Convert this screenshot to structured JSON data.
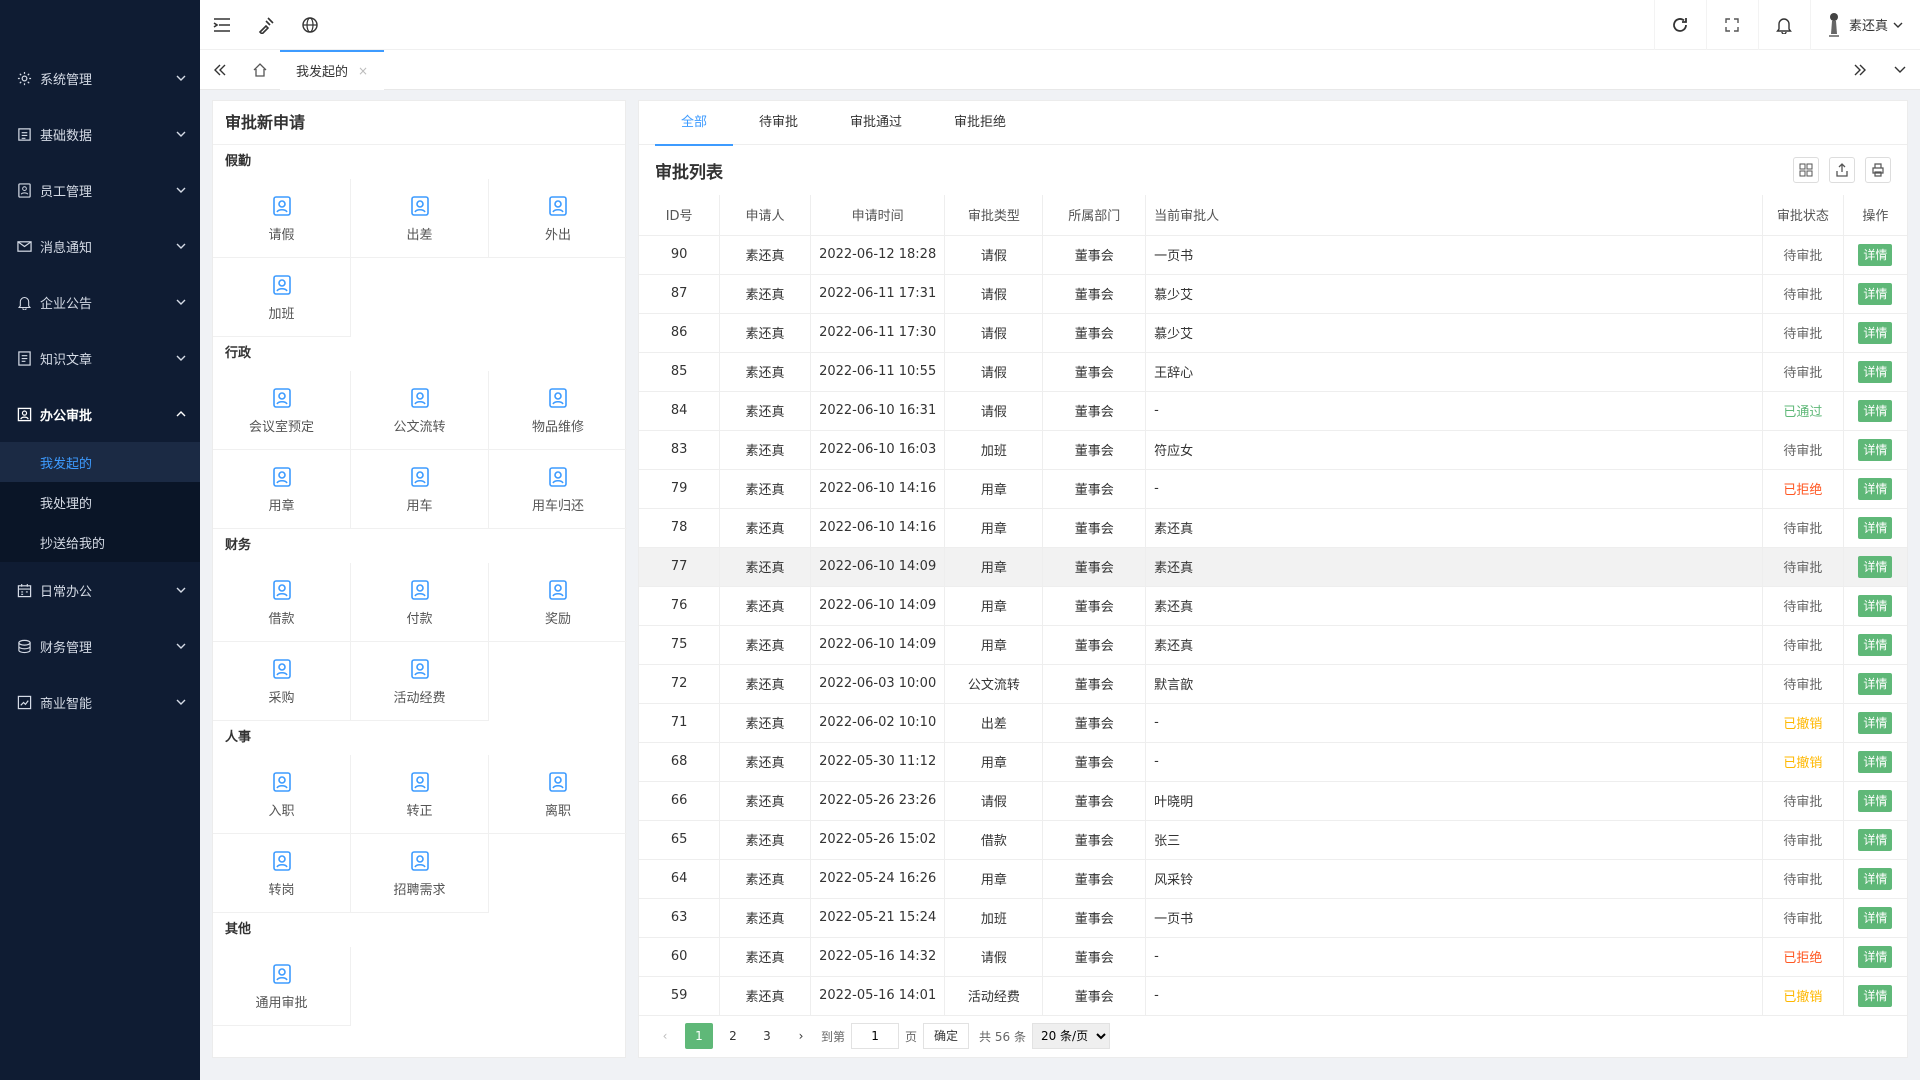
{
  "sidebar": {
    "items": [
      {
        "label": "系统管理",
        "icon": "gear-icon"
      },
      {
        "label": "基础数据",
        "icon": "database-icon"
      },
      {
        "label": "员工管理",
        "icon": "employee-icon"
      },
      {
        "label": "消息通知",
        "icon": "message-icon"
      },
      {
        "label": "企业公告",
        "icon": "bell-icon"
      },
      {
        "label": "知识文章",
        "icon": "article-icon"
      },
      {
        "label": "办公审批",
        "icon": "approval-icon"
      },
      {
        "label": "日常办公",
        "icon": "calendar-icon"
      },
      {
        "label": "财务管理",
        "icon": "finance-icon"
      },
      {
        "label": "商业智能",
        "icon": "chart-icon"
      }
    ],
    "sub_items": [
      {
        "label": "我发起的"
      },
      {
        "label": "我处理的"
      },
      {
        "label": "抄送给我的"
      }
    ]
  },
  "topbar": {
    "user_name": "素还真"
  },
  "tabbar": {
    "active_tab": "我发起的",
    "close_glyph": "×"
  },
  "apply": {
    "title": "审批新申请",
    "groups": [
      {
        "title": "假勤",
        "items": [
          "请假",
          "出差",
          "外出",
          "加班"
        ]
      },
      {
        "title": "行政",
        "items": [
          "会议室预定",
          "公文流转",
          "物品维修",
          "用章",
          "用车",
          "用车归还"
        ]
      },
      {
        "title": "财务",
        "items": [
          "借款",
          "付款",
          "奖励",
          "采购",
          "活动经费"
        ]
      },
      {
        "title": "人事",
        "items": [
          "入职",
          "转正",
          "离职",
          "转岗",
          "招聘需求"
        ]
      },
      {
        "title": "其他",
        "items": [
          "通用审批"
        ]
      }
    ]
  },
  "status_tabs": [
    "全部",
    "待审批",
    "审批通过",
    "审批拒绝"
  ],
  "list": {
    "title": "审批列表",
    "columns": [
      "ID号",
      "申请人",
      "申请时间",
      "审批类型",
      "所属部门",
      "当前审批人",
      "审批状态",
      "操作"
    ],
    "detail_label": "详情",
    "rows": [
      [
        "90",
        "素还真",
        "2022-06-12 18:28",
        "请假",
        "董事会",
        "一页书",
        "待审批"
      ],
      [
        "87",
        "素还真",
        "2022-06-11 17:31",
        "请假",
        "董事会",
        "慕少艾",
        "待审批"
      ],
      [
        "86",
        "素还真",
        "2022-06-11 17:30",
        "请假",
        "董事会",
        "慕少艾",
        "待审批"
      ],
      [
        "85",
        "素还真",
        "2022-06-11 10:55",
        "请假",
        "董事会",
        "王辞心",
        "待审批"
      ],
      [
        "84",
        "素还真",
        "2022-06-10 16:31",
        "请假",
        "董事会",
        "-",
        "已通过"
      ],
      [
        "83",
        "素还真",
        "2022-06-10 16:03",
        "加班",
        "董事会",
        "符应女",
        "待审批"
      ],
      [
        "79",
        "素还真",
        "2022-06-10 14:16",
        "用章",
        "董事会",
        "-",
        "已拒绝"
      ],
      [
        "78",
        "素还真",
        "2022-06-10 14:16",
        "用章",
        "董事会",
        "素还真",
        "待审批"
      ],
      [
        "77",
        "素还真",
        "2022-06-10 14:09",
        "用章",
        "董事会",
        "素还真",
        "待审批"
      ],
      [
        "76",
        "素还真",
        "2022-06-10 14:09",
        "用章",
        "董事会",
        "素还真",
        "待审批"
      ],
      [
        "75",
        "素还真",
        "2022-06-10 14:09",
        "用章",
        "董事会",
        "素还真",
        "待审批"
      ],
      [
        "72",
        "素还真",
        "2022-06-03 10:00",
        "公文流转",
        "董事会",
        "默言歆",
        "待审批"
      ],
      [
        "71",
        "素还真",
        "2022-06-02 10:10",
        "出差",
        "董事会",
        "-",
        "已撤销"
      ],
      [
        "68",
        "素还真",
        "2022-05-30 11:12",
        "用章",
        "董事会",
        "-",
        "已撤销"
      ],
      [
        "66",
        "素还真",
        "2022-05-26 23:26",
        "请假",
        "董事会",
        "叶晓明",
        "待审批"
      ],
      [
        "65",
        "素还真",
        "2022-05-26 15:02",
        "借款",
        "董事会",
        "张三",
        "待审批"
      ],
      [
        "64",
        "素还真",
        "2022-05-24 16:26",
        "用章",
        "董事会",
        "风采铃",
        "待审批"
      ],
      [
        "63",
        "素还真",
        "2022-05-21 15:24",
        "加班",
        "董事会",
        "一页书",
        "待审批"
      ],
      [
        "60",
        "素还真",
        "2022-05-16 14:32",
        "请假",
        "董事会",
        "-",
        "已拒绝"
      ],
      [
        "59",
        "素还真",
        "2022-05-16 14:01",
        "活动经费",
        "董事会",
        "-",
        "已撤销"
      ]
    ],
    "highlight_row": 8
  },
  "pager": {
    "prev": "‹",
    "next": "›",
    "pages": [
      "1",
      "2",
      "3"
    ],
    "current": "1",
    "goto_label": "到第",
    "goto_value": "1",
    "page_unit": "页",
    "confirm": "确定",
    "total": "共 56 条",
    "page_size": "20 条/页"
  },
  "colors": {
    "sidebar_bg": "#0f1c33",
    "accent": "#3d9bff",
    "green": "#5fb878",
    "rejected": "#ff5722",
    "revoked": "#ffb800"
  }
}
